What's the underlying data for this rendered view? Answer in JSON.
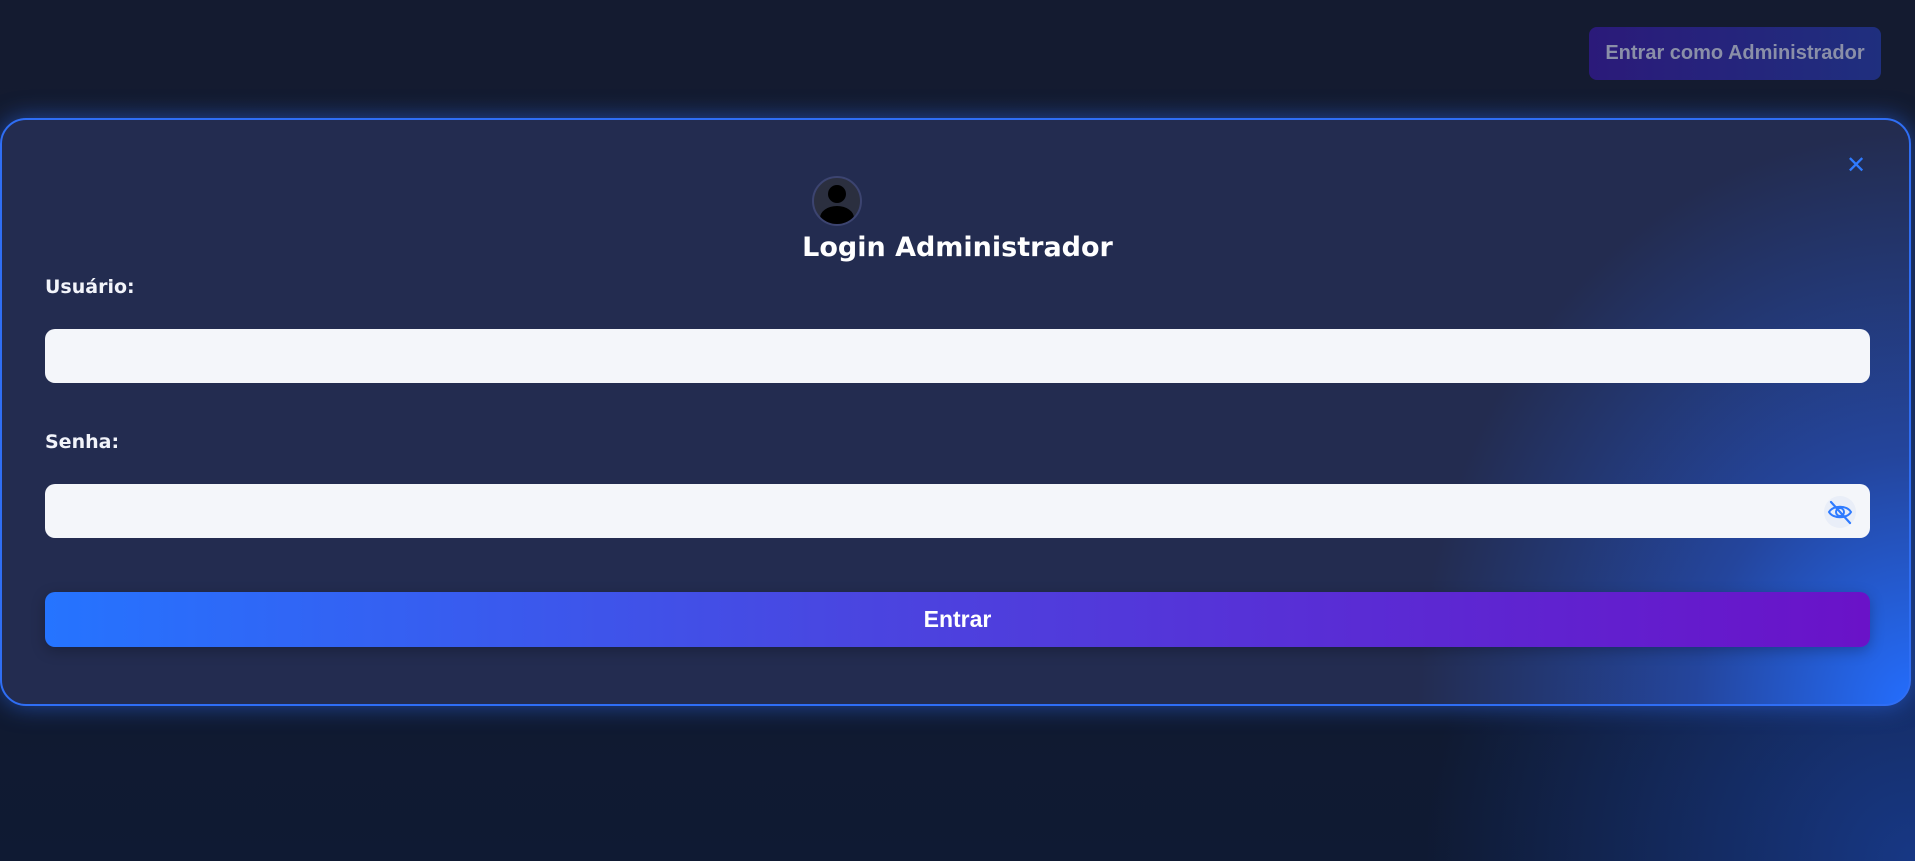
{
  "header": {
    "admin_button_label": "Entrar como Administrador"
  },
  "modal": {
    "close_icon": "close-icon",
    "avatar_icon": "user-avatar-icon",
    "title": "Login Administrador",
    "fields": {
      "username": {
        "label": "Usuário:",
        "value": "",
        "placeholder": ""
      },
      "password": {
        "label": "Senha:",
        "value": "",
        "placeholder": "",
        "visibility_icon": "eye-slash-icon"
      }
    },
    "submit_label": "Entrar"
  },
  "colors": {
    "accent": "#2f6ef5",
    "button_gradient_start": "#2574ff",
    "button_gradient_end": "#6a12c8",
    "modal_bg": "#232c50",
    "page_bg": "#121a2e"
  }
}
